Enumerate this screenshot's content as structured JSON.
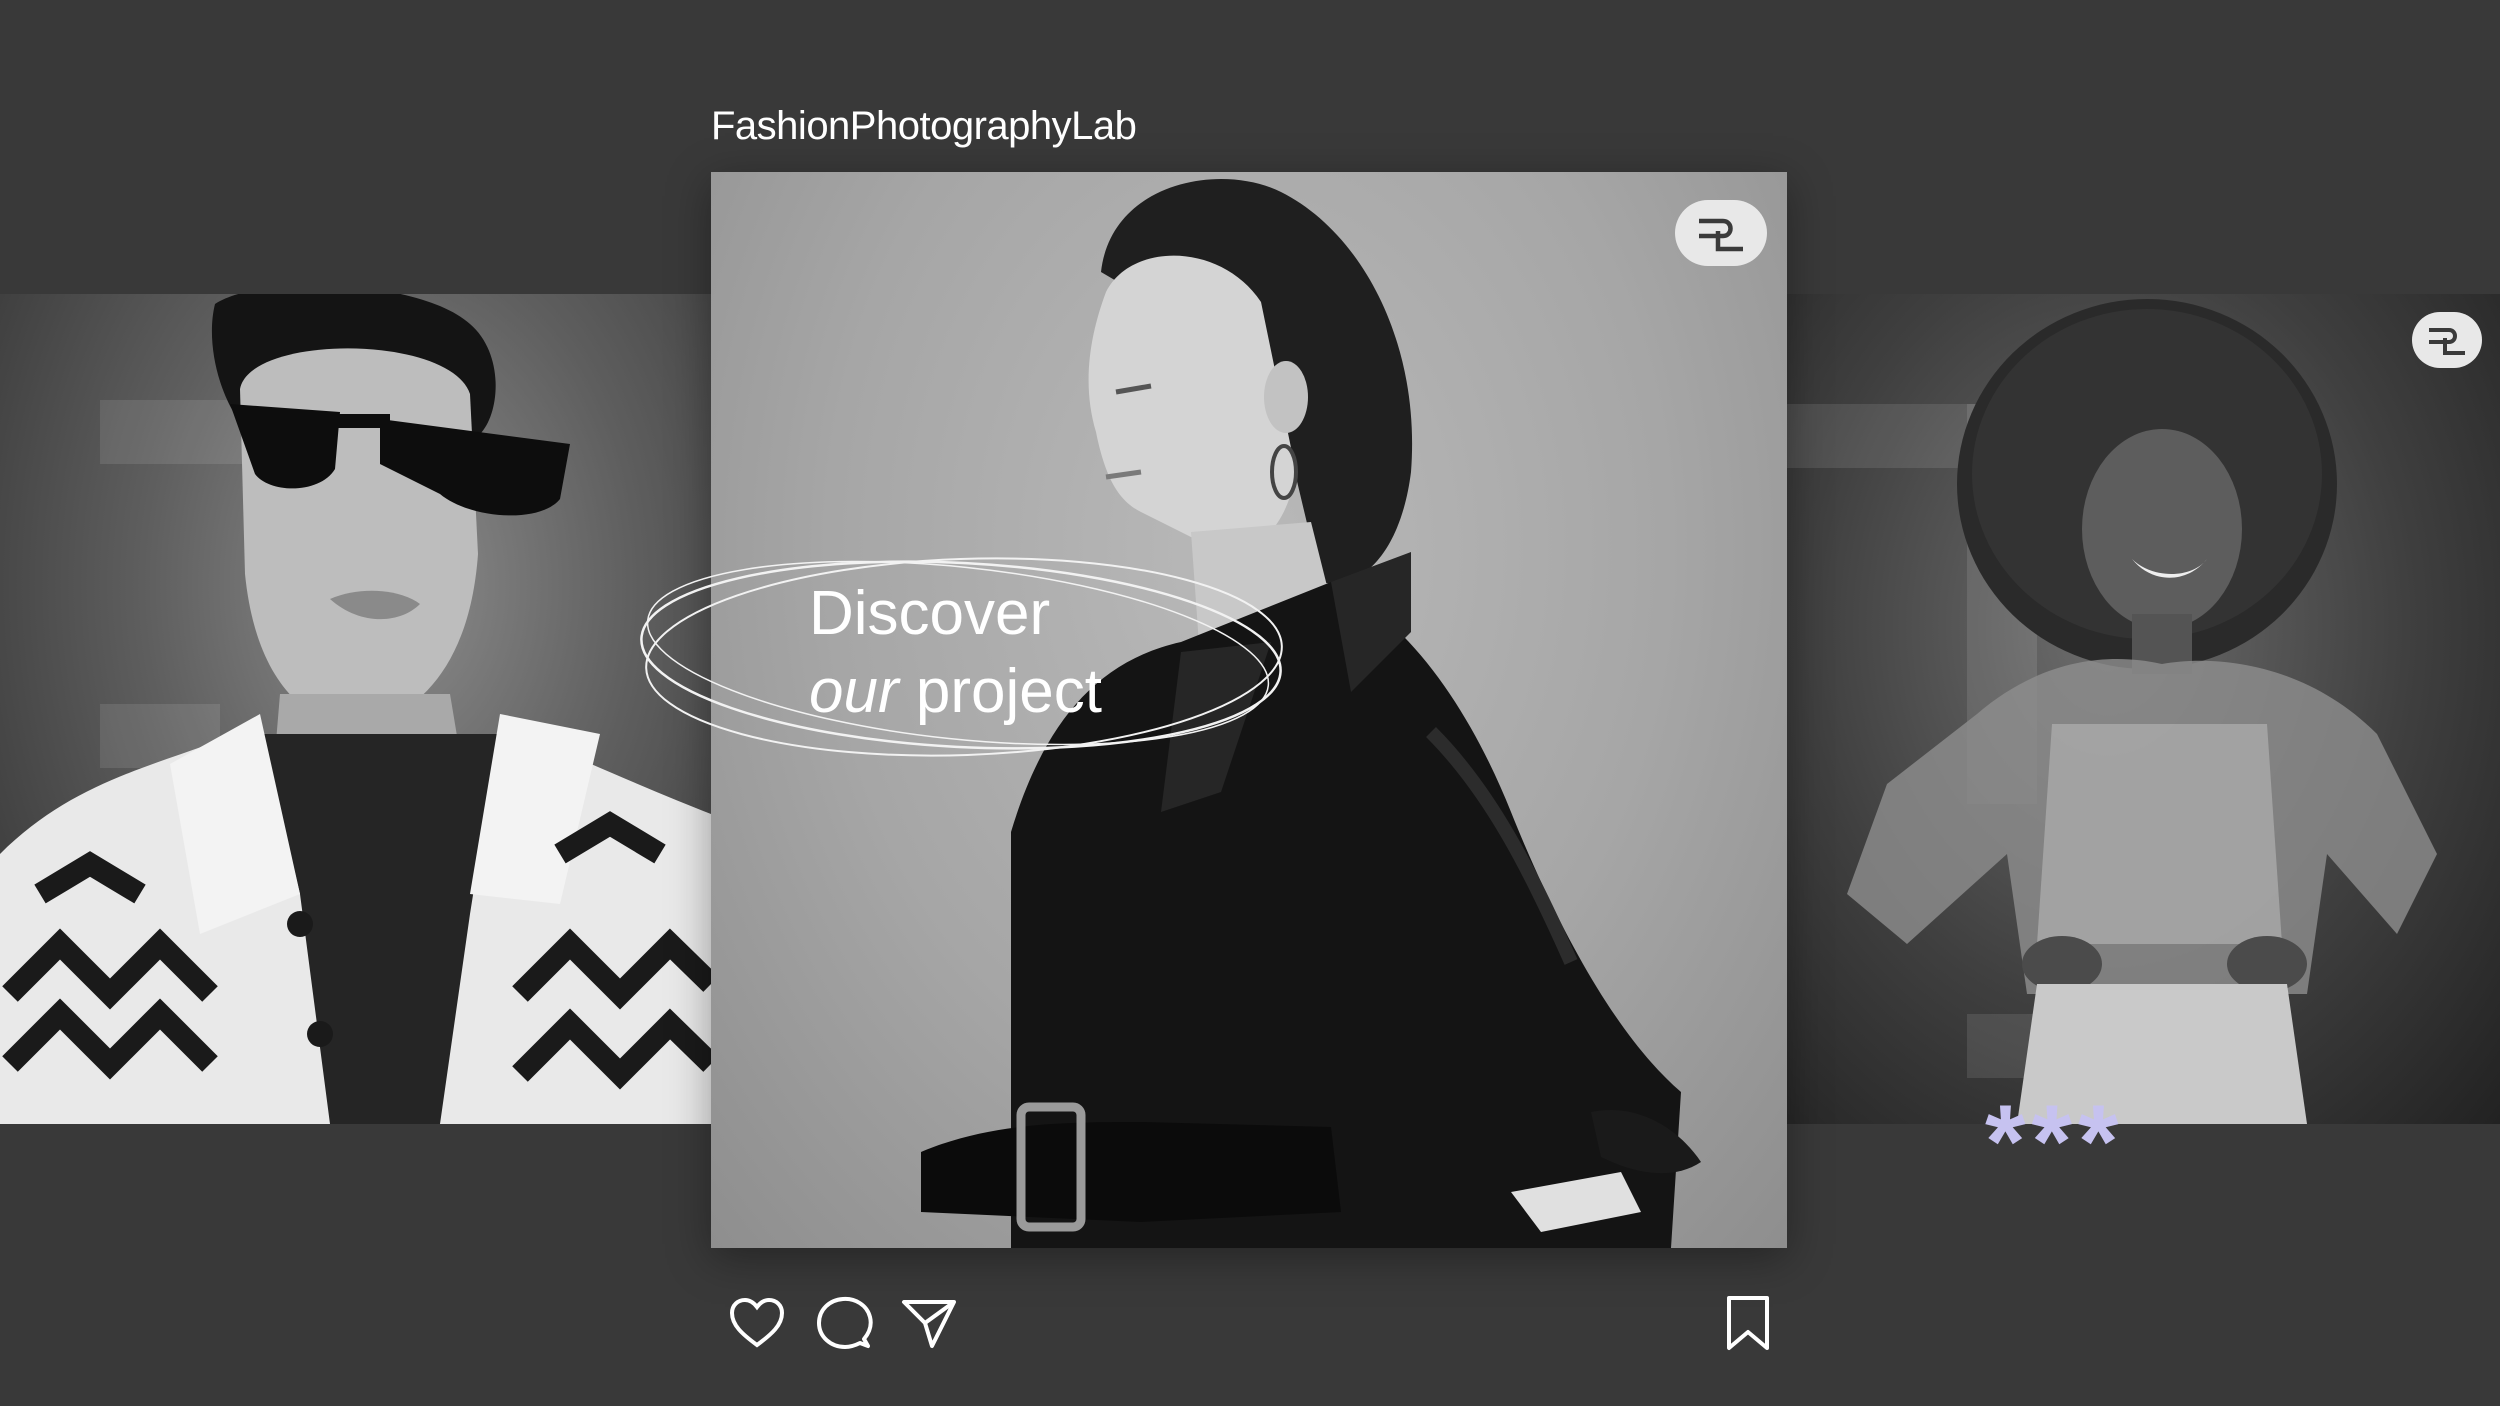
{
  "account": {
    "name": "FashionPhotographyLab"
  },
  "post": {
    "headline_line1": "Discover",
    "headline_italic": "our",
    "headline_line2_rest": " project"
  },
  "decorations": {
    "stars": "***",
    "star_color": "#c6c2f0"
  },
  "actions": [
    {
      "icon": "heart-icon"
    },
    {
      "icon": "comment-icon"
    },
    {
      "icon": "send-icon"
    },
    {
      "icon": "bookmark-icon"
    }
  ],
  "colors": {
    "background": "#393939",
    "text": "#ffffff",
    "badge": "#e8e8e8"
  }
}
